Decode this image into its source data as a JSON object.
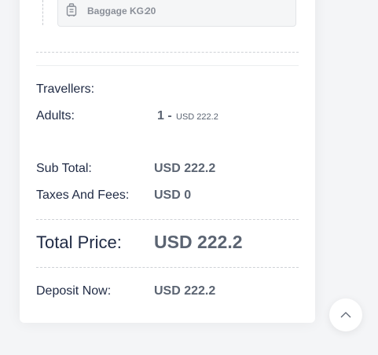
{
  "baggage": {
    "label": "Baggage KG:",
    "value": "20",
    "icon": "luggage-icon"
  },
  "summary": {
    "travellers_label": "Travellers:",
    "adults_label": "Adults:",
    "adults_count": "1 -",
    "adults_price": "USD 222.2",
    "subtotal_label": "Sub Total:",
    "subtotal_value": "USD 222.2",
    "taxes_label": "Taxes And Fees:",
    "taxes_value": "USD 0",
    "total_label": "Total Price:",
    "total_value": "USD 222.2",
    "deposit_label": "Deposit Now:",
    "deposit_value": "USD 222.2"
  },
  "scroll_top": {
    "icon": "chevron-up-icon"
  },
  "colors": {
    "label_text": "#1f2a44",
    "value_text": "#5b6472",
    "muted_text": "#8a8f98"
  }
}
